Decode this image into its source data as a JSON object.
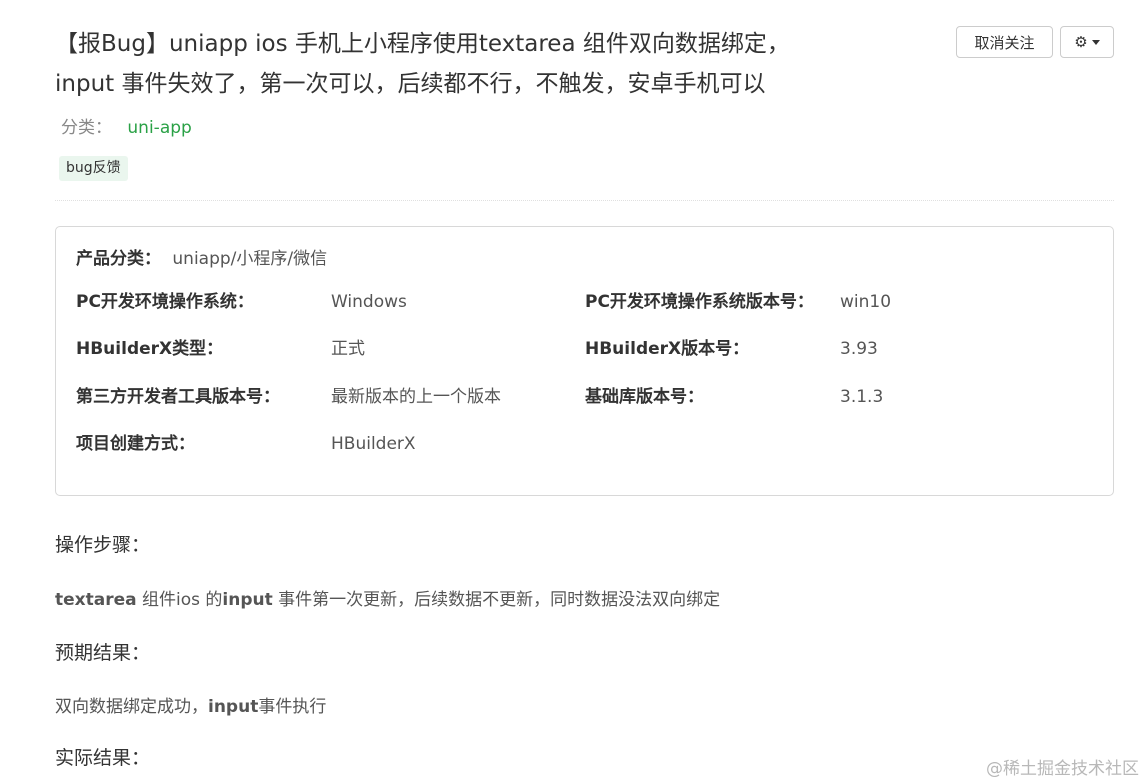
{
  "post": {
    "title_line1": "【报Bug】uniapp ios 手机上小程序使用textarea 组件双向数据绑定，",
    "title_line2": "input 事件失效了，第一次可以，后续都不行，不触发，安卓手机可以",
    "category_label": "分类：",
    "category_value": "uni-app",
    "tag": "bug反馈"
  },
  "actions": {
    "follow_label": "取消关注",
    "settings_icon": "gear-icon",
    "dropdown_icon": "caret-down-icon"
  },
  "info": {
    "product_label": "产品分类：",
    "product_value": "uniapp/小程序/微信",
    "os_label": "PC开发环境操作系统：",
    "os_value": "Windows",
    "os_version_label": "PC开发环境操作系统版本号：",
    "os_version_value": "win10",
    "hbx_type_label": "HBuilderX类型：",
    "hbx_type_value": "正式",
    "hbx_version_label": "HBuilderX版本号：",
    "hbx_version_value": "3.93",
    "third_tool_label": "第三方开发者工具版本号：",
    "third_tool_value": "最新版本的上一个版本",
    "lib_version_label": "基础库版本号：",
    "lib_version_value": "3.1.3",
    "create_method_label": "项目创建方式：",
    "create_method_value": "HBuilderX"
  },
  "sections": {
    "steps_title": "操作步骤：",
    "steps_b1": "textarea",
    "steps_t1": " 组件ios 的",
    "steps_b2": "input",
    "steps_t2": " 事件第一次更新，后续数据不更新，同时数据没法双向绑定",
    "expected_title": "预期结果：",
    "expected_t1": "双向数据绑定成功，",
    "expected_b1": "input",
    "expected_t2": "事件执行",
    "actual_title": "实际结果："
  },
  "watermark": "@稀土掘金技术社区"
}
